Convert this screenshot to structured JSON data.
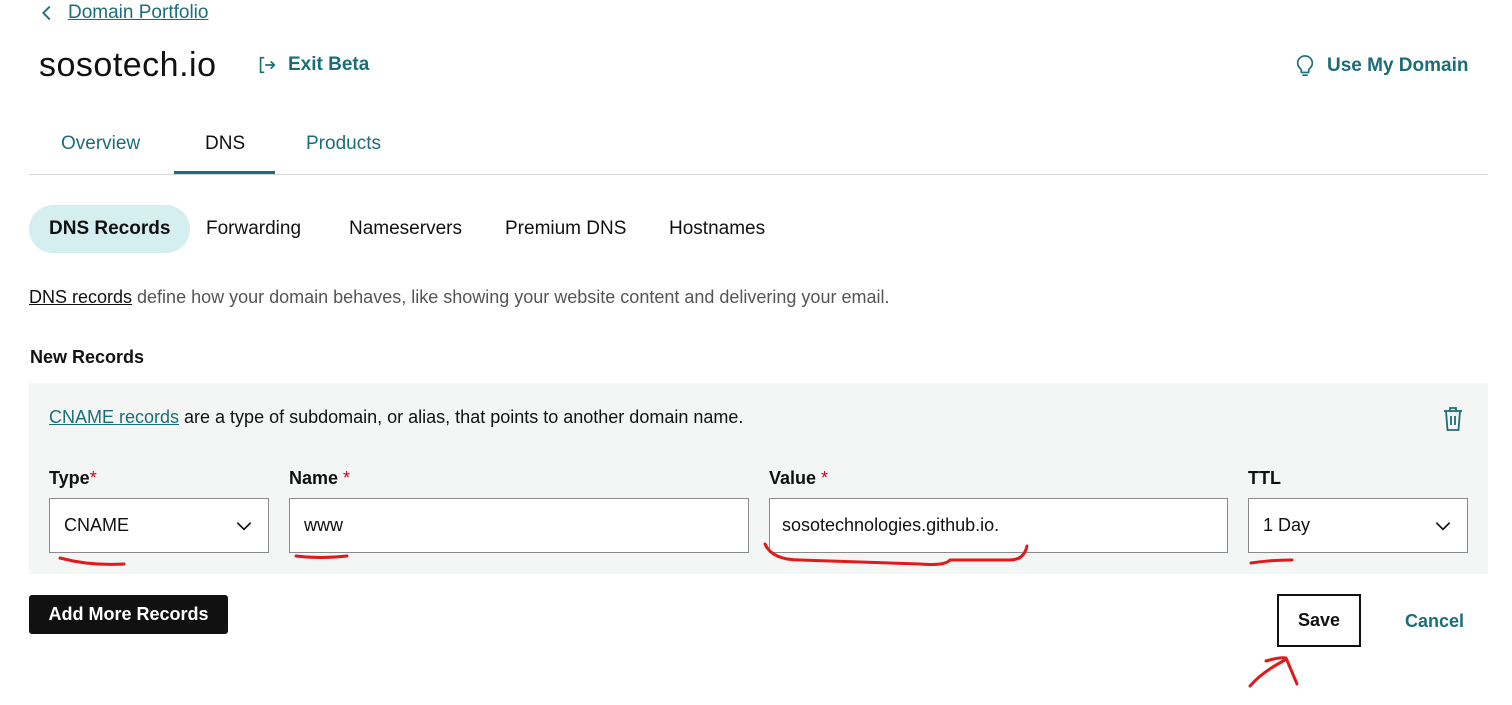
{
  "breadcrumb": {
    "label": "Domain Portfolio",
    "icon": "chevron-left-icon"
  },
  "header": {
    "domain_title": "sosotech.io",
    "exit_beta_label": "Exit Beta",
    "exit_beta_icon": "exit-icon",
    "use_my_domain_label": "Use My Domain",
    "use_my_domain_icon": "lightbulb-icon"
  },
  "main_tabs": [
    {
      "label": "Overview",
      "active": false
    },
    {
      "label": "DNS",
      "active": true
    },
    {
      "label": "Products",
      "active": false
    }
  ],
  "sub_tabs": [
    {
      "label": "DNS Records",
      "active": true
    },
    {
      "label": "Forwarding",
      "active": false
    },
    {
      "label": "Nameservers",
      "active": false
    },
    {
      "label": "Premium DNS",
      "active": false
    },
    {
      "label": "Hostnames",
      "active": false
    }
  ],
  "intro": {
    "link_text": "DNS records",
    "text": " define how your domain behaves, like showing your website content and delivering your email."
  },
  "new_records": {
    "heading": "New Records",
    "record_info_link": "CNAME records",
    "record_info_text": " are a type of subdomain, or alias, that points to another domain name.",
    "delete_icon": "trash-icon",
    "fields": {
      "type": {
        "label": "Type",
        "required_mark": "*",
        "value": "CNAME"
      },
      "name": {
        "label": "Name",
        "required_mark": "*",
        "value": "www"
      },
      "value": {
        "label": "Value",
        "required_mark": "*",
        "value": "sosotechnologies.github.io."
      },
      "ttl": {
        "label": "TTL",
        "value": "1 Day"
      }
    }
  },
  "actions": {
    "add_more_label": "Add More Records",
    "save_label": "Save",
    "cancel_label": "Cancel"
  },
  "colors": {
    "accent": "#1b6e78",
    "active_subtab_bg": "#d5eef0",
    "panel_bg": "#f4f5f5",
    "required": "#d0021b",
    "annotation": "#e01b1b"
  }
}
